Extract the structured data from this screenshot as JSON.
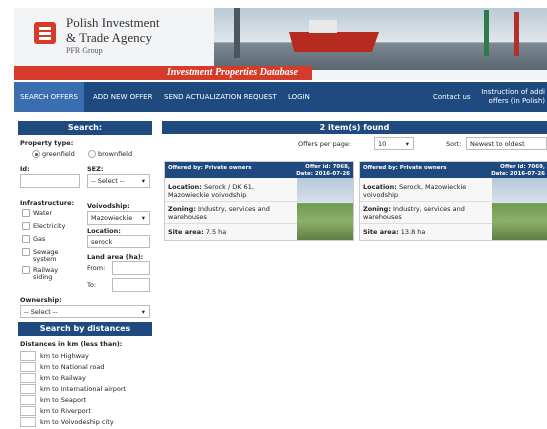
{
  "header": {
    "brand_line1": "Polish Investment",
    "brand_line2": "& Trade Agency",
    "brand_line3": "PFR Group",
    "banner": "Investment Properties Database"
  },
  "nav": {
    "items": [
      "SEARCH OFFERS",
      "ADD NEW OFFER",
      "SEND ACTUALIZATION REQUEST",
      "LOGIN",
      "Contact us"
    ],
    "instr_line1": "Instruction of addi",
    "instr_line2": "offers (in Polish)"
  },
  "search": {
    "title": "Search:",
    "property_type_label": "Property type:",
    "greenfield": "greenfield",
    "brownfield": "brownfield",
    "id_label": "Id:",
    "sez_label": "SEZ:",
    "sez_value": "-- Select --",
    "infrastructure_label": "Infrastructure:",
    "infra": [
      "Water",
      "Electricity",
      "Gas",
      "Sewage",
      "system",
      "Railway",
      "siding"
    ],
    "voivodship_label": "Voivodship:",
    "voivodship_value": "Mazowieckie",
    "location_label": "Location:",
    "location_value": "serock",
    "land_area_label": "Land area (ha):",
    "from_label": "From:",
    "to_label": "To:",
    "ownership_label": "Ownership:",
    "ownership_value": "-- Select --"
  },
  "distances": {
    "title": "Search by distances",
    "subtitle": "Distances in km (less than):",
    "items": [
      "km to Highway",
      "km to National road",
      "km to Railway",
      "km to International airport",
      "km to Seaport",
      "km to Riverport",
      "km to Voivodeship city"
    ]
  },
  "results": {
    "found": "2 item(s) found",
    "per_page_label": "Offers per page:",
    "per_page_value": "10",
    "sort_label": "Sort:",
    "sort_value": "Newest to oldest",
    "offers": [
      {
        "offered_by": "Offered by: Private owners",
        "offer_id": "Offer id: 7068,",
        "date": "Date: 2016-07-26",
        "location_label": "Location:",
        "location": " Serock / DK 61,",
        "location2": "Mazowieckie voivodship",
        "zoning_label": "Zoning:",
        "zoning": " Industry, services and",
        "zoning2": "warehouses",
        "area_label": "Site area:",
        "area": " 7.5 ha"
      },
      {
        "offered_by": "Offered by: Private owners",
        "offer_id": "Offer id: 7069,",
        "date": "Date: 2016-07-26",
        "location_label": "Location:",
        "location": " Serock, Mazowieckie",
        "location2": "voivodship",
        "zoning_label": "Zoning:",
        "zoning": " Industry, services and",
        "zoning2": "warehouses",
        "area_label": "Site area:",
        "area": " 13.8 ha"
      }
    ]
  },
  "colors": {
    "navy": "#1e4a80",
    "red": "#d63b2a",
    "active_tab": "#3a6eb0"
  }
}
